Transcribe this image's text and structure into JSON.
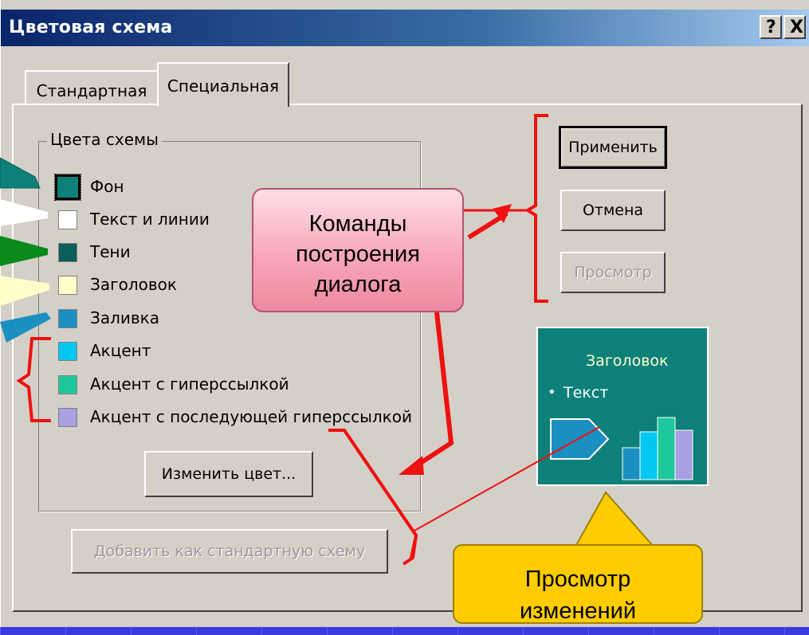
{
  "window": {
    "title": "Цветовая схема",
    "help_label": "?",
    "close_label": "X"
  },
  "tabs": [
    {
      "label": "Стандартная",
      "active": false
    },
    {
      "label": "Специальная",
      "active": true
    }
  ],
  "scheme_colors": {
    "group_label": "Цвета схемы",
    "items": [
      {
        "label": "Фон",
        "color": "#0e807a",
        "selected": true
      },
      {
        "label": "Текст и линии",
        "color": "#ffffff",
        "selected": false
      },
      {
        "label": "Тени",
        "color": "#0b5f5b",
        "selected": false
      },
      {
        "label": "Заголовок",
        "color": "#ffffcc",
        "selected": false
      },
      {
        "label": "Заливка",
        "color": "#1a8fc0",
        "selected": false
      },
      {
        "label": "Акцент",
        "color": "#00c8f0",
        "selected": false
      },
      {
        "label": "Акцент с гиперссылкой",
        "color": "#1fc89a",
        "selected": false
      },
      {
        "label": "Акцент с последующей гиперссылкой",
        "color": "#a8a0e0",
        "selected": false
      }
    ],
    "change_color_label": "Изменить цвет..."
  },
  "buttons": {
    "apply": "Применить",
    "cancel": "Отмена",
    "preview": "Просмотр",
    "add_standard": "Добавить как стандартную схему"
  },
  "preview_box": {
    "title": "Заголовок",
    "bullet_text": "Текст",
    "bar_colors": [
      "#1a8fc0",
      "#00c8f0",
      "#1fc89a",
      "#a8a0e0"
    ]
  },
  "callouts": {
    "dialog_commands": [
      "Команды",
      "построения",
      "диалога"
    ],
    "view_changes": [
      "Просмотр",
      "изменений"
    ]
  },
  "arrow_colors": [
    "#0e807a",
    "#ffffff",
    "#0a8a1a",
    "#ffffcc",
    "#1a8fc0"
  ],
  "accent_red": "#ee1111"
}
